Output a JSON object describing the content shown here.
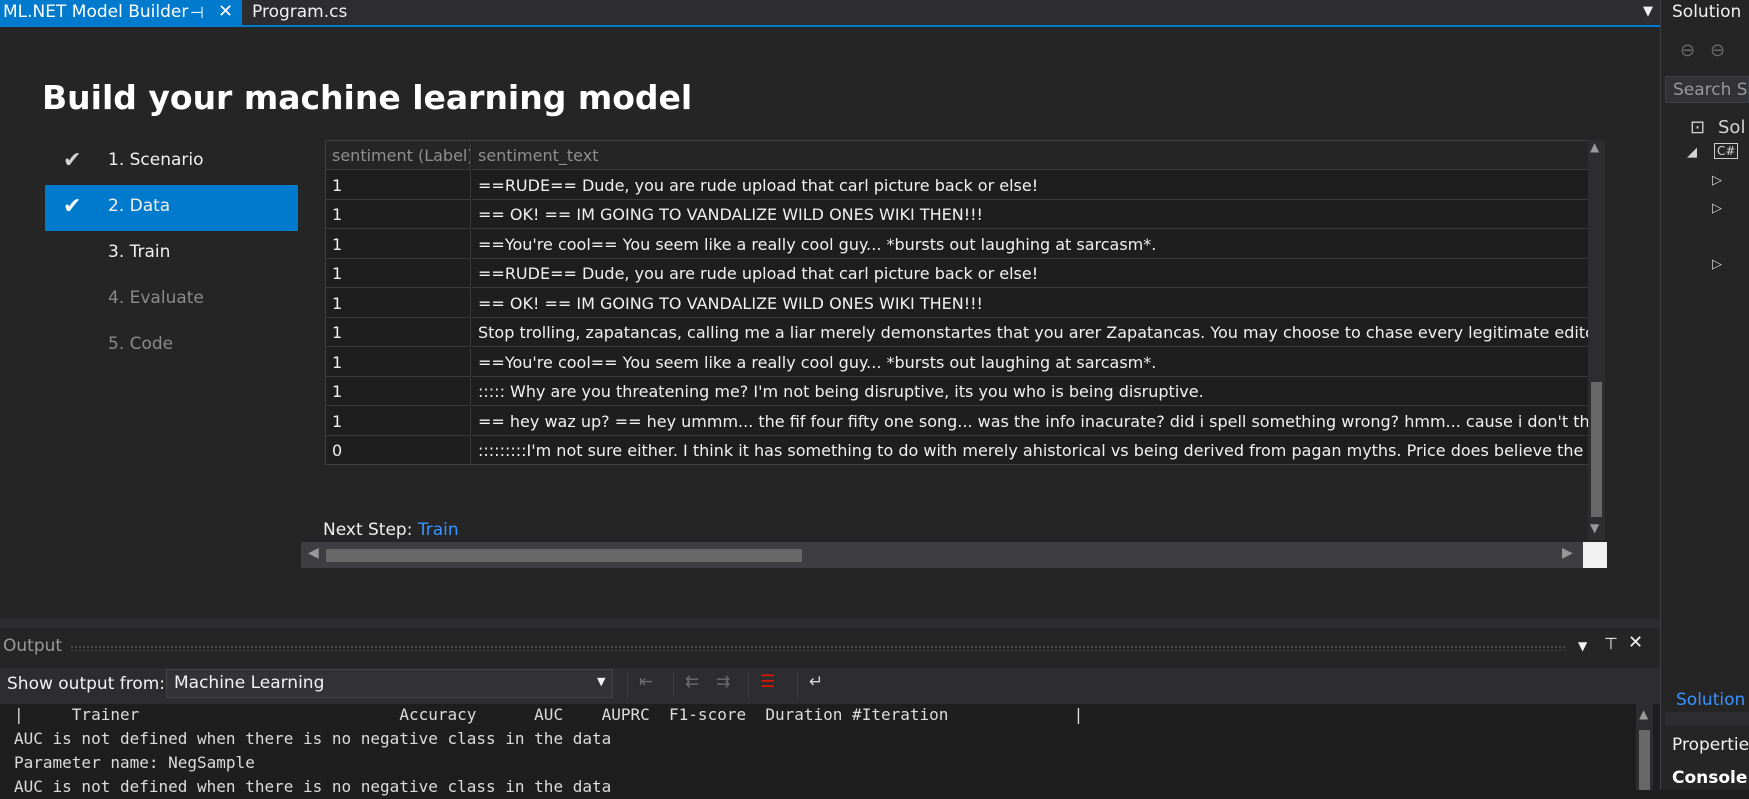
{
  "tabs": {
    "active_label": "ML.NET Model Builder",
    "inactive_label": "Program.cs"
  },
  "page": {
    "title": "Build your machine learning model"
  },
  "steps": [
    {
      "label": "1. Scenario",
      "done": true,
      "enabled": true
    },
    {
      "label": "2. Data",
      "done": true,
      "enabled": true,
      "active": true
    },
    {
      "label": "3. Train",
      "done": false,
      "enabled": true
    },
    {
      "label": "4. Evaluate",
      "done": false,
      "enabled": false
    },
    {
      "label": "5. Code",
      "done": false,
      "enabled": false
    }
  ],
  "grid": {
    "headers": [
      "sentiment (Label)",
      "sentiment_text"
    ],
    "rows": [
      [
        "1",
        "  ==RUDE== Dude, you are rude upload that carl picture back or else!"
      ],
      [
        "1",
        "  == OK! == IM GOING TO VANDALIZE WILD ONES WIKI THEN!!!"
      ],
      [
        "1",
        "  ==You're cool==  You seem like a really cool guy... *bursts out laughing at sarcasm*."
      ],
      [
        "1",
        "  ==RUDE== Dude, you are rude upload that carl picture back or else!"
      ],
      [
        "1",
        "  == OK! == IM GOING TO VANDALIZE WILD ONES WIKI THEN!!!"
      ],
      [
        "1",
        "  Stop trolling, zapatancas, calling me a liar merely demonstartes that you arer Zapatancas. You may choose to chase every legitimate editor f"
      ],
      [
        "1",
        "  ==You're cool==  You seem like a really cool guy... *bursts out laughing at sarcasm*."
      ],
      [
        "1",
        "::::: Why are you threatening me? I'm not being disruptive, its you who is being disruptive."
      ],
      [
        "1",
        "  == hey waz up? ==  hey ummm... the fif four fifty one song... was the info inacurate?  did i spell something wrong? hmm... cause i don't thi"
      ],
      [
        "0",
        ":::::::::I'm not sure either. I think it has something to do with merely ahistorical vs being derived from pagan myths. Price does believe the latt"
      ]
    ]
  },
  "next_step": {
    "label": "Next Step:",
    "link": "Train"
  },
  "solution_explorer": {
    "title": "Solution",
    "search_placeholder": "Search S",
    "root_label": "Sol",
    "tab_link": "Solution",
    "properties_title": "Propertie",
    "properties_sub": "Console"
  },
  "output": {
    "title": "Output",
    "show_from_label": "Show output from:",
    "show_from_value": "Machine Learning",
    "lines": [
      "|     Trainer                           Accuracy      AUC    AUPRC  F1-score  Duration #Iteration             |",
      "AUC is not defined when there is no negative class in the data",
      "Parameter name: NegSample",
      "AUC is not defined when there is no negative class in the data"
    ]
  },
  "colors": {
    "accent": "#007acc",
    "link": "#3794ff",
    "background": "#1e1e1e"
  }
}
